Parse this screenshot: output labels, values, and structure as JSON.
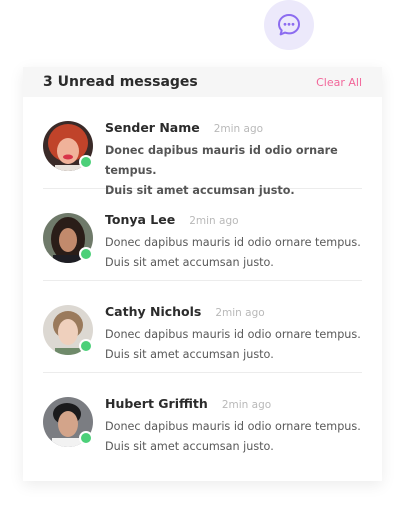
{
  "header": {
    "title": "3 Unread messages",
    "clear_all": "Clear All"
  },
  "chat_icon": "chat-bubble-icon",
  "colors": {
    "accent": "#f2679a",
    "icon": "#8c6cf0",
    "icon_bg": "#ece9fb",
    "online": "#4cd079"
  },
  "messages": [
    {
      "sender": "Sender Name",
      "time": "2min ago",
      "line1": "Donec dapibus mauris id odio ornare tempus.",
      "line2": "Duis sit amet accumsan justo.",
      "unread": true,
      "online": true
    },
    {
      "sender": "Tonya Lee",
      "time": "2min ago",
      "line1": "Donec dapibus mauris id odio ornare tempus.",
      "line2": "Duis sit amet accumsan justo.",
      "unread": false,
      "online": true
    },
    {
      "sender": "Cathy Nichols",
      "time": "2min ago",
      "line1": "Donec dapibus mauris id odio ornare tempus.",
      "line2": "Duis sit amet accumsan justo.",
      "unread": false,
      "online": true
    },
    {
      "sender": "Hubert Griffith",
      "time": "2min ago",
      "line1": "Donec dapibus mauris id odio ornare tempus.",
      "line2": "Duis sit amet accumsan justo.",
      "unread": false,
      "online": true
    }
  ]
}
